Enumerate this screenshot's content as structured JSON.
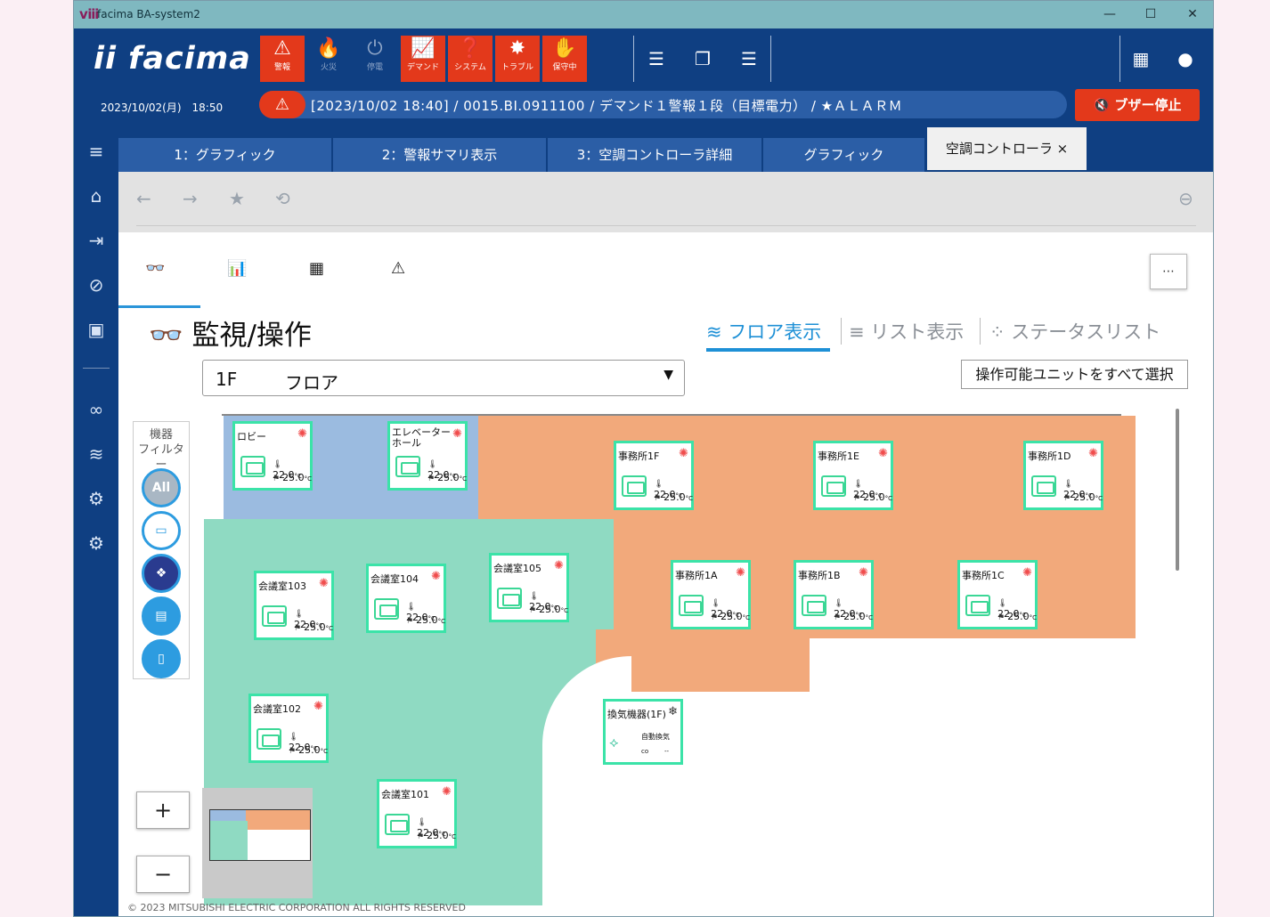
{
  "window": {
    "title": "facima BA-system2",
    "logo": "ⅷ",
    "minimize": "—",
    "maximize": "☐",
    "close": "✕"
  },
  "header": {
    "brand": "ii facima",
    "top_icons": [
      {
        "label": "警報",
        "icon": "warning-icon",
        "glyph": "⚠"
      },
      {
        "label": "火災",
        "icon": "flame-icon",
        "glyph": "🔥"
      },
      {
        "label": "停電",
        "icon": "power-off-icon",
        "glyph": "⏻"
      },
      {
        "label": "デマンド",
        "icon": "demand-chart-icon",
        "glyph": "📈"
      },
      {
        "label": "システム",
        "icon": "system-icon",
        "glyph": "❓"
      },
      {
        "label": "トラブル",
        "icon": "trouble-icon",
        "glyph": "✸"
      },
      {
        "label": "保守中",
        "icon": "maintenance-icon",
        "glyph": "✋"
      }
    ],
    "datetime": "2023/10/02(月)　18:50",
    "alarm_message": "[2023/10/02 18:40] / 0015.BI.0911100 / デマンド１警報１段（目標電力） / ★ＡＬＡＲＭ",
    "buzzer_stop": "🔇 ブザー停止",
    "accent_red": "#e3391b",
    "nav_blue": "#0f3f82"
  },
  "tabs": [
    {
      "label": "1：グラフィック"
    },
    {
      "label": "2：警報サマリ表示"
    },
    {
      "label": "3：空調コントローラ詳細"
    },
    {
      "label": "グラフィック"
    },
    {
      "label": "空調コントローラ ×"
    }
  ],
  "nav": {
    "back": "←",
    "forward": "→",
    "favorite": "★",
    "refresh": "⟲",
    "collapse": "⊖"
  },
  "toolbar": {
    "monitor": "👓",
    "trend": "📊",
    "schedule": "▦",
    "alarm": "⚠",
    "more": "⋯"
  },
  "page": {
    "title": "監視/操作",
    "title_icon": "👓",
    "view_floor": "フロア表示",
    "view_list": "リスト表示",
    "view_status": "ステータスリスト",
    "floor_id": "1F",
    "floor_name": "フロア",
    "select_all": "操作可能ユニットをすべて選択"
  },
  "filter": {
    "title": "機器\nフィルター",
    "all": "All"
  },
  "units": [
    {
      "name": "ロビー",
      "temp": "22.0",
      "set": "25.0"
    },
    {
      "name": "エレベーター\nホール",
      "temp": "22.0",
      "set": "25.0"
    },
    {
      "name": "事務所1F",
      "temp": "22.0",
      "set": "25.0"
    },
    {
      "name": "事務所1E",
      "temp": "22.0",
      "set": "25.0"
    },
    {
      "name": "事務所1D",
      "temp": "22.0",
      "set": "25.0"
    },
    {
      "name": "会議室103",
      "temp": "22.0",
      "set": "25.0"
    },
    {
      "name": "会議室104",
      "temp": "22.0",
      "set": "25.0"
    },
    {
      "name": "会議室105",
      "temp": "22.0",
      "set": "25.0"
    },
    {
      "name": "事務所1A",
      "temp": "22.0",
      "set": "25.0"
    },
    {
      "name": "事務所1B",
      "temp": "22.0",
      "set": "25.0"
    },
    {
      "name": "事務所1C",
      "temp": "22.0",
      "set": "25.0"
    },
    {
      "name": "会議室102",
      "temp": "22.0",
      "set": "25.0"
    },
    {
      "name": "会議室101",
      "temp": "22.0",
      "set": "25.0"
    }
  ],
  "unit_unit": "°C",
  "ventilation": {
    "name": "換気機器(1F)",
    "mode": "自動換気",
    "co": "co",
    "val": "--"
  },
  "zoom": {
    "in": "+",
    "out": "−"
  },
  "copyright": "© 2023 MITSUBISHI ELECTRIC CORPORATION ALL RIGHTS RESERVED"
}
